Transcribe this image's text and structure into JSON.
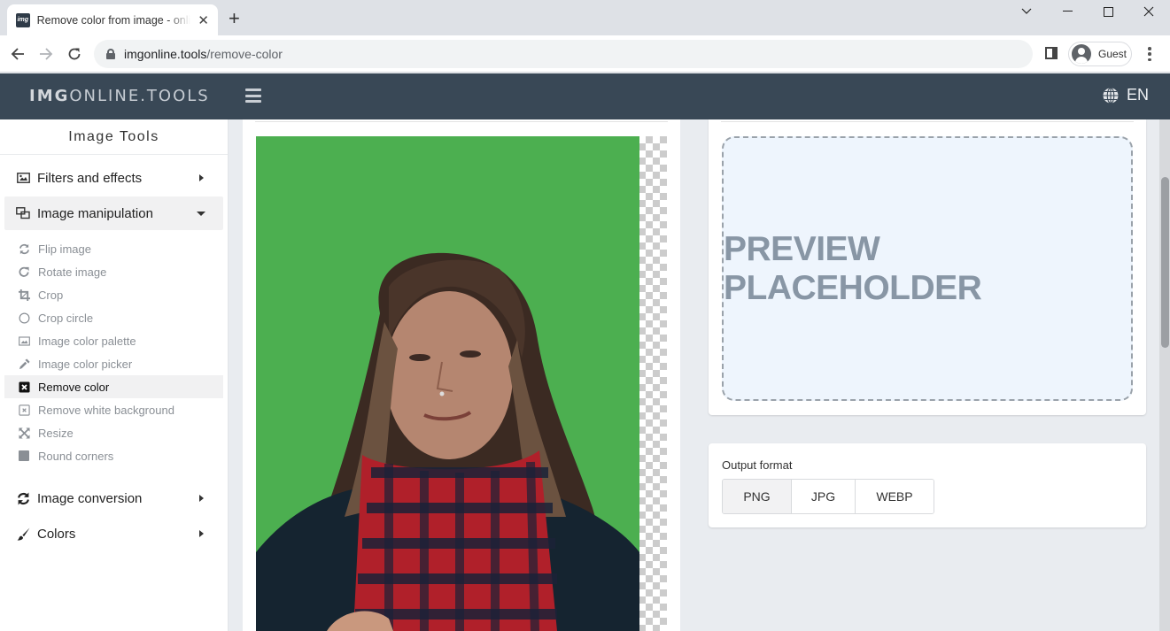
{
  "browser": {
    "tab_title": "Remove color from image - online",
    "favicon_text": "img",
    "url_host": "imgonline.tools",
    "url_path": "/remove-color",
    "profile_name": "Guest",
    "icons": {
      "back": "arrow-left-icon",
      "forward": "arrow-right-icon",
      "reload": "reload-icon",
      "lock": "lock-icon",
      "new_tab": "plus-icon",
      "close_tab": "close-icon",
      "side_panel": "side-panel-icon",
      "menu": "kebab-menu-icon"
    },
    "window_controls": {
      "tab_search": "⌄",
      "minimize": "—",
      "maximize": "☐",
      "close": "✕"
    }
  },
  "header": {
    "logo_bold": "IMG",
    "logo_rest": "ONLINE.TOOLS",
    "language": "EN",
    "colors": {
      "background": "#394856"
    }
  },
  "sidebar": {
    "title": "Image Tools",
    "categories": [
      {
        "label": "Filters and effects",
        "icon": "image-icon",
        "expanded": false
      },
      {
        "label": "Image manipulation",
        "icon": "object-ungroup-icon",
        "expanded": true,
        "items": [
          {
            "label": "Flip image",
            "icon": "sync-icon"
          },
          {
            "label": "Rotate image",
            "icon": "redo-icon"
          },
          {
            "label": "Crop",
            "icon": "crop-icon"
          },
          {
            "label": "Crop circle",
            "icon": "circle-icon"
          },
          {
            "label": "Image color palette",
            "icon": "image-icon"
          },
          {
            "label": "Image color picker",
            "icon": "eyedropper-icon"
          },
          {
            "label": "Remove color",
            "icon": "times-square-icon",
            "active": true
          },
          {
            "label": "Remove white background",
            "icon": "times-square-outline-icon"
          },
          {
            "label": "Resize",
            "icon": "expand-arrows-icon"
          },
          {
            "label": "Round corners",
            "icon": "square-icon"
          }
        ]
      },
      {
        "label": "Image conversion",
        "icon": "sync-icon",
        "expanded": false
      },
      {
        "label": "Colors",
        "icon": "paint-brush-icon",
        "expanded": false
      }
    ]
  },
  "main": {
    "source_image": {
      "background_color": "#4caf50",
      "description": "Portrait of a woman with long hair and red plaid scarf on green background"
    },
    "preview": {
      "placeholder_text": "PREVIEW PLACEHOLDER"
    },
    "output_format": {
      "label": "Output format",
      "options": [
        "PNG",
        "JPG",
        "WEBP"
      ],
      "selected": "PNG"
    }
  }
}
